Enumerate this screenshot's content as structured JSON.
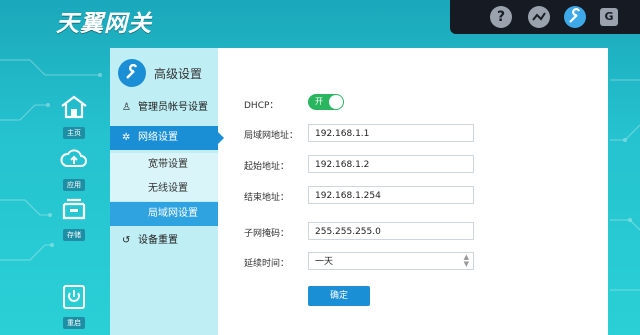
{
  "brand": {
    "logo_text": "天翼网关"
  },
  "topbar": {
    "icons": [
      "help-icon",
      "chart-icon",
      "wrench-icon",
      "logout-icon"
    ],
    "active_icon": "wrench-icon"
  },
  "leftnav": {
    "items": [
      {
        "label": "主页",
        "icon": "home-icon"
      },
      {
        "label": "应用",
        "icon": "cloud-upload-icon"
      },
      {
        "label": "存储",
        "icon": "storage-icon"
      },
      {
        "label": "重启",
        "icon": "power-icon"
      }
    ]
  },
  "sidebar": {
    "title": "高级设置",
    "items": [
      {
        "label": "管理员帐号设置",
        "icon": "user-icon"
      },
      {
        "label": "网络设置",
        "icon": "gear-icon"
      },
      {
        "label": "设备重置",
        "icon": "reset-icon"
      }
    ],
    "subitems": [
      {
        "label": "宽带设置"
      },
      {
        "label": "无线设置"
      },
      {
        "label": "局域网设置"
      }
    ]
  },
  "form": {
    "dhcp": {
      "label": "DHCP：",
      "state": "开"
    },
    "lan_addr": {
      "label": "局域网地址：",
      "value": "192.168.1.1"
    },
    "start_addr": {
      "label": "起始地址：",
      "value": "192.168.1.2"
    },
    "end_addr": {
      "label": "结束地址：",
      "value": "192.168.1.254"
    },
    "subnet_mask": {
      "label": "子网掩码：",
      "value": "255.255.255.0"
    },
    "lease_time": {
      "label": "延续时间：",
      "value": "一天"
    },
    "submit_label": "确定"
  },
  "colors": {
    "accent": "#1a8fd5",
    "toggle_on": "#2ab55f",
    "background": "#25c2cf"
  }
}
